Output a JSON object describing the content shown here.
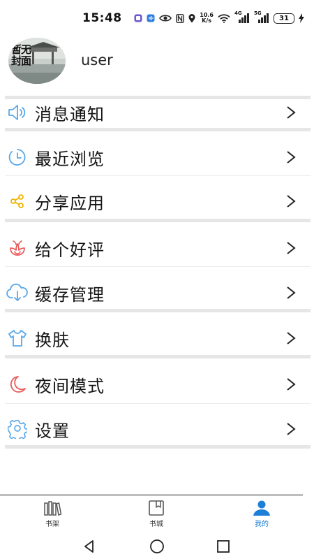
{
  "status_bar": {
    "time": "15:48",
    "net_speed_value": "10.6",
    "net_speed_unit": "K/s",
    "signal_1": "4G",
    "signal_2": "5G",
    "battery": "31"
  },
  "profile": {
    "avatar_text": "暂无封面",
    "username": "user"
  },
  "menu": {
    "items": [
      {
        "label": "消息通知",
        "icon": "speaker-icon",
        "color": "#5aa7e8"
      },
      {
        "label": "最近浏览",
        "icon": "clock-icon",
        "color": "#5aa7e8"
      },
      {
        "label": "分享应用",
        "icon": "share-icon",
        "color": "#f0b400"
      },
      {
        "label": "给个好评",
        "icon": "flower-icon",
        "color": "#e85a5a"
      },
      {
        "label": "缓存管理",
        "icon": "cloud-download-icon",
        "color": "#5aa7e8"
      },
      {
        "label": "换肤",
        "icon": "tshirt-icon",
        "color": "#5aa7e8"
      },
      {
        "label": "夜间模式",
        "icon": "moon-icon",
        "color": "#e85a5a"
      },
      {
        "label": "设置",
        "icon": "gear-icon",
        "color": "#5aa7e8"
      }
    ]
  },
  "bottom_nav": {
    "items": [
      {
        "label": "书架",
        "icon": "bookshelf-icon",
        "active": false
      },
      {
        "label": "书城",
        "icon": "bookstore-icon",
        "active": false
      },
      {
        "label": "我的",
        "icon": "person-icon",
        "active": true
      }
    ],
    "active_color": "#1e7fd8"
  }
}
